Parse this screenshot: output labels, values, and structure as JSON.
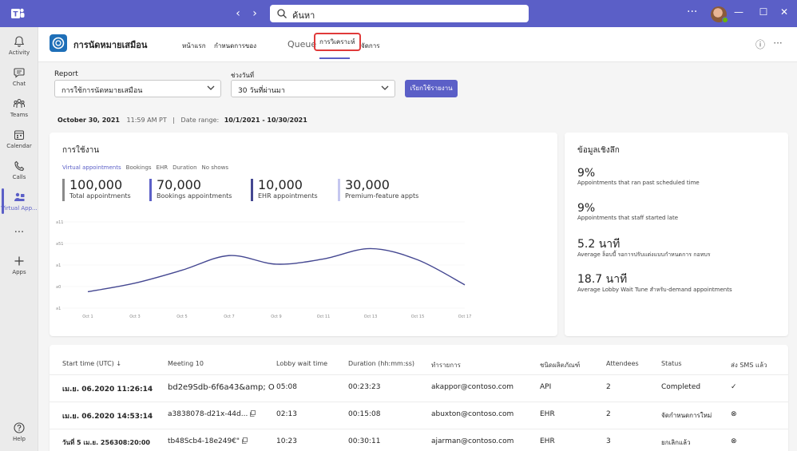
{
  "titlebar": {
    "search_placeholder": "ค้นหา",
    "back_arrow": "‹",
    "forward_arrow": "›",
    "more": "···",
    "minimize": "—",
    "maximize": "☐",
    "close": "✕"
  },
  "rail": {
    "items": [
      {
        "label": "Activity",
        "icon": "bell-icon"
      },
      {
        "label": "Chat",
        "icon": "chat-icon"
      },
      {
        "label": "Teams",
        "icon": "teams-icon"
      },
      {
        "label": "Calendar",
        "icon": "calendar-icon"
      },
      {
        "label": "Calls",
        "icon": "phone-icon"
      },
      {
        "label": "Virtual App...",
        "icon": "virtual-appointments-icon"
      },
      {
        "label": "···",
        "icon": "more-icon"
      },
      {
        "label": "Apps",
        "icon": "plus-icon"
      },
      {
        "label": "Help",
        "icon": "help-icon"
      }
    ],
    "active_index": 5
  },
  "header": {
    "app_name": "การนัดหมายเสมือน",
    "tabs": [
      "หน้าแรก",
      "กำหนดการของ",
      "Queue",
      "การวิเคราะห์",
      "จัดการ"
    ],
    "selected_tab": "การวิเคราะห์",
    "info_icon": "ⓘ",
    "more_icon": "···"
  },
  "filters": {
    "report_label": "Report",
    "report_value": "การใช้การนัดหมายเสมือน",
    "range_label": "ช่วงวันที่",
    "range_value": "30 วันที่ผ่านมา",
    "run_button": "เรียกใช้รายงาน"
  },
  "meta": {
    "date": "October 30, 2021",
    "time": "11:59 AM PT",
    "sep": "|",
    "range_label": "Date range:",
    "range_value": "10/1/2021 - 10/30/2021"
  },
  "usage": {
    "title": "การใช้งาน",
    "tabs": [
      "Virtual appointments",
      "Bookings",
      "EHR",
      "Duration",
      "No shows"
    ],
    "kpis": [
      {
        "value": "100,000",
        "label": "Total appointments",
        "color": "#8a8a8a"
      },
      {
        "value": "70,000",
        "label": "Bookings appointments",
        "color": "#5b5fc7"
      },
      {
        "value": "10,000",
        "label": "EHR appointments",
        "color": "#444791"
      },
      {
        "value": "30,000",
        "label": "Premium-feature appts",
        "color": "#c5c7f0"
      }
    ]
  },
  "chart_data": {
    "type": "line",
    "x": [
      "Oct 1",
      "Oct 3",
      "Oct 5",
      "Oct 7",
      "Oct 9",
      "Oct 11",
      "Oct 13",
      "Oct 15",
      "Oct 17"
    ],
    "y_tick_labels": [
      "ล11",
      "ล51",
      "ล1",
      "ล0",
      "ล1"
    ],
    "series": [
      {
        "color": "#444791",
        "values": [
          0.95,
          1.45,
          2.2,
          3.05,
          2.55,
          2.85,
          3.45,
          2.8,
          1.35
        ]
      }
    ],
    "ylim": [
      0,
      5
    ],
    "grid": true
  },
  "insights": {
    "title": "ข้อมูลเชิงลึก",
    "items": [
      {
        "big": "9%",
        "small": "Appointments that ran past scheduled time"
      },
      {
        "big": "9%",
        "small": "Appointments that staff started late"
      },
      {
        "big": "5.2  นาที",
        "small": "Average ล็อบบี้ รอการปรับแต่งแบบกำหนดการ กอทบร"
      },
      {
        "big": "18.7  นาที",
        "small": "Average Lobby Wait Tune สำหรับ-demand appointments"
      }
    ]
  },
  "table": {
    "headers": [
      "Start time (UTC)",
      "Meeting 10",
      "Lobby wait time",
      "Duration (hh:mm:ss)",
      "ทำรายการ",
      "ชนิดผลิตภัณฑ์",
      "Attendees",
      "Status",
      "ส่ง SMS แล้ว"
    ],
    "sort_icon": "↓",
    "rows": [
      {
        "start": "เม.ย. 06.2020 11:26:14",
        "meeting": "bd2e9Sdb-6f6a43&amp; O",
        "lobby": "05:08",
        "duration": "00:23:23",
        "email": "akappor@contoso.com",
        "product": "API",
        "attendees": "2",
        "status": "Completed",
        "sms": "✓"
      },
      {
        "start": "เม.ย. 06.2020 14:53:14",
        "meeting": "a3838078-d21x-44d...",
        "lobby": "02:13",
        "duration": "00:15:08",
        "email": "abuxton@contoso.com",
        "product": "EHR",
        "attendees": "2",
        "status": "จัดกำหนดการใหม่",
        "sms": "⊗"
      },
      {
        "start": "วันที่ 5 เม.ย. 256308:20:00",
        "meeting": "tb48Scb4-18e249€\"",
        "lobby": "10:23",
        "duration": "00:30:11",
        "email": "ajarman@contoso.com",
        "product": "EHR",
        "attendees": "3",
        "status": "ยกเลิกแล้ว",
        "sms": "⊗"
      }
    ]
  }
}
